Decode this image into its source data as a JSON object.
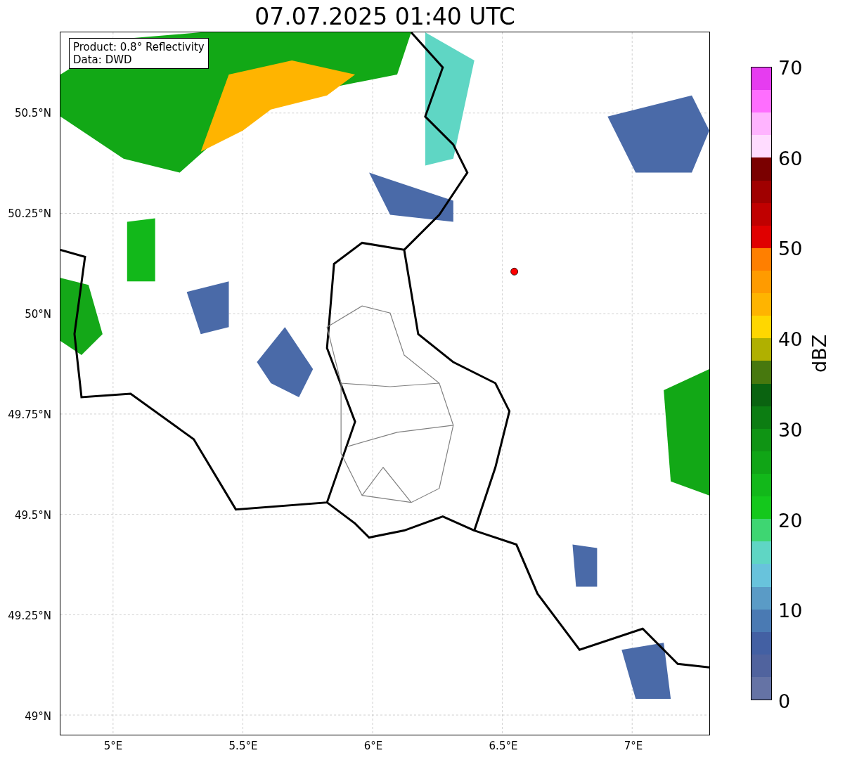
{
  "title": "07.07.2025 01:40 UTC",
  "info_box": [
    "Product: 0.8° Reflectivity",
    "Data: DWD"
  ],
  "map": {
    "xticks": [
      "5°E",
      "5.5°E",
      "6°E",
      "6.5°E",
      "7°E"
    ],
    "yticks": [
      "50.5°N",
      "50.25°N",
      "50°N",
      "49.75°N",
      "49.5°N",
      "49.25°N",
      "49°N"
    ]
  },
  "colorbar": {
    "label": "dBZ",
    "ticks": [
      "70",
      "60",
      "50",
      "40",
      "30",
      "20",
      "10",
      "0"
    ],
    "bands": [
      {
        "color": "#6573a5"
      },
      {
        "color": "#50639e"
      },
      {
        "color": "#4360a3"
      },
      {
        "color": "#4a7ab3"
      },
      {
        "color": "#5a9bc6"
      },
      {
        "color": "#68c3dc"
      },
      {
        "color": "#5fd6c4"
      },
      {
        "color": "#3ed672"
      },
      {
        "color": "#14c81c"
      },
      {
        "color": "#12b81a"
      },
      {
        "color": "#10a516"
      },
      {
        "color": "#0f9414"
      },
      {
        "color": "#0c7d12"
      },
      {
        "color": "#0a6310"
      },
      {
        "color": "#47780e"
      },
      {
        "color": "#b0b000"
      },
      {
        "color": "#ffd700"
      },
      {
        "color": "#ffb400"
      },
      {
        "color": "#ff9b00"
      },
      {
        "color": "#ff7f00"
      },
      {
        "color": "#e00000"
      },
      {
        "color": "#c00000"
      },
      {
        "color": "#a00000"
      },
      {
        "color": "#7a0000"
      },
      {
        "color": "#ffdcff"
      },
      {
        "color": "#ffb4ff"
      },
      {
        "color": "#ff6eff"
      },
      {
        "color": "#e63cf0"
      }
    ]
  }
}
